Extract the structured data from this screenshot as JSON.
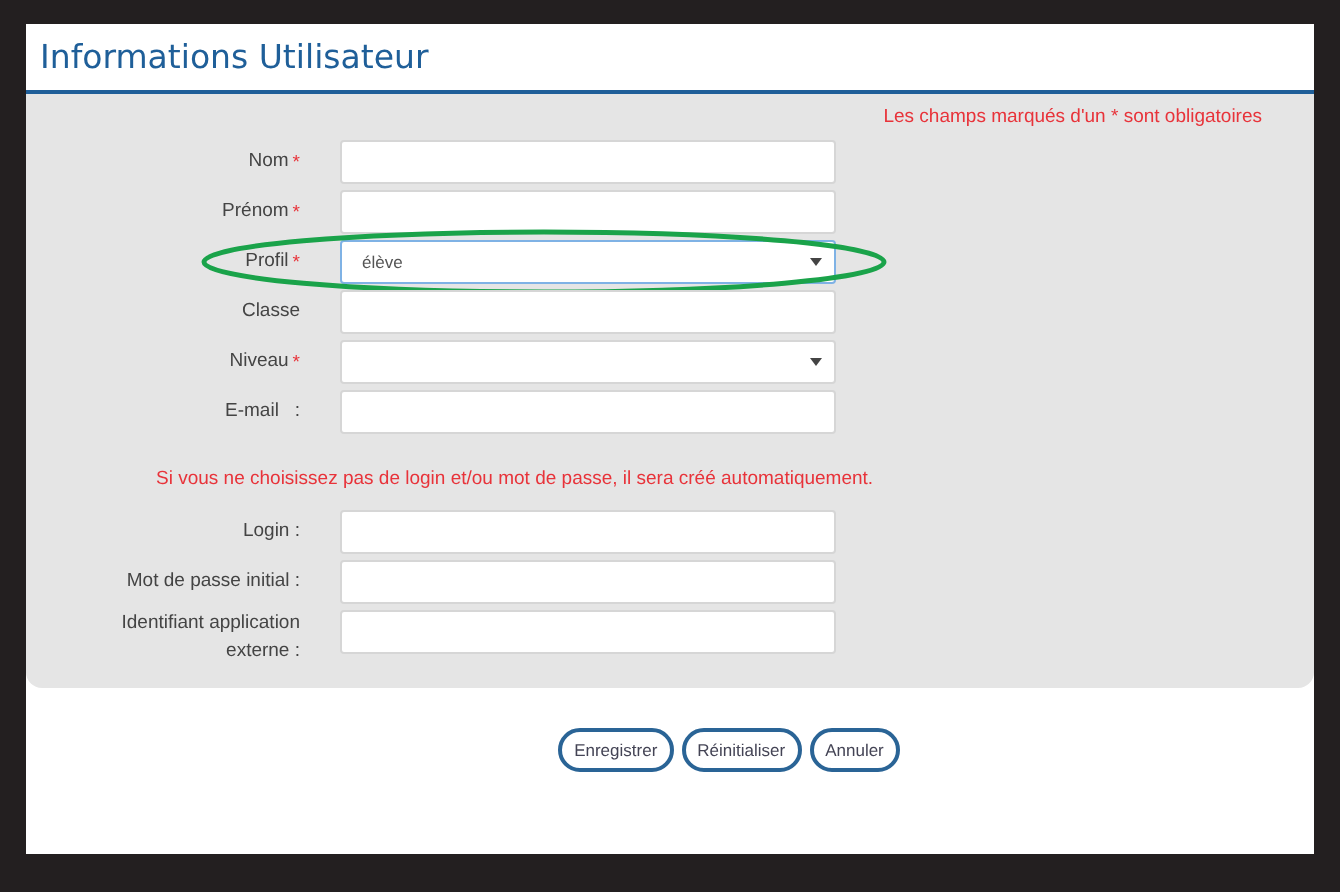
{
  "title": "Informations Utilisateur",
  "required_note": "Les champs marqués d'un * sont obligatoires",
  "fields": [
    {
      "label": "Nom",
      "required_mark": "*",
      "kind": "text",
      "focused": false,
      "highlighted": false
    },
    {
      "label": "Prénom",
      "required_mark": "*",
      "kind": "text",
      "focused": false,
      "highlighted": false
    },
    {
      "label": "Profil",
      "required_mark": "*",
      "kind": "select",
      "value": "élève",
      "focused": true,
      "highlighted": true
    },
    {
      "label": "Classe",
      "kind": "text",
      "focused": false,
      "highlighted": false
    },
    {
      "label": "Niveau",
      "required_mark": "*",
      "kind": "select",
      "focused": false,
      "highlighted": false
    },
    {
      "label": "E-mail   :",
      "kind": "text",
      "focused": false,
      "highlighted": false
    }
  ],
  "login_note": "Si vous ne choisissez pas de login et/ou mot de passe, il sera créé automatiquement.",
  "login_fields": [
    {
      "label": "Login :",
      "kind": "text",
      "focused": false,
      "highlighted": false
    },
    {
      "label": "Mot de passe initial :",
      "kind": "text",
      "focused": false,
      "highlighted": false
    },
    {
      "label": "Identifiant application externe :",
      "kind": "text",
      "focused": false,
      "highlighted": false
    }
  ],
  "buttons": [
    "Enregistrer",
    "Réinitialiser",
    "Annuler"
  ]
}
